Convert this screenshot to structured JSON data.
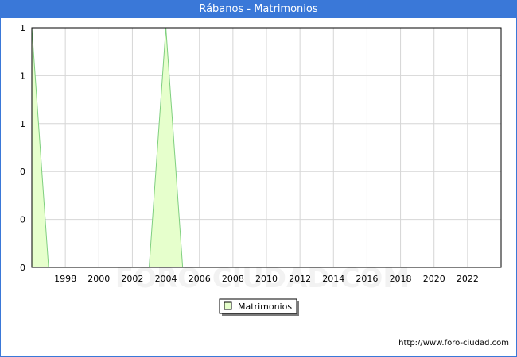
{
  "window": {
    "title": "Rábanos - Matrimonios"
  },
  "watermark": "FORO-CIUDAD.COM",
  "footer": {
    "url": "http://www.foro-ciudad.com"
  },
  "colors": {
    "title_bar": "#3a78d8",
    "area_fill": "#e6ffcc",
    "area_line": "#7fcf7f",
    "grid": "#d6d6d6"
  },
  "chart_data": {
    "type": "area",
    "title": "Rábanos - Matrimonios",
    "xlabel": "",
    "ylabel": "",
    "x_ticks": [
      "1998",
      "2000",
      "2002",
      "2004",
      "2006",
      "2008",
      "2010",
      "2012",
      "2014",
      "2016",
      "2018",
      "2020",
      "2022"
    ],
    "y_ticks": [
      "0",
      "0",
      "0",
      "1",
      "1",
      "1"
    ],
    "xlim": [
      1996,
      2024
    ],
    "ylim": [
      0,
      1
    ],
    "grid": true,
    "legend_position": "bottom-center",
    "series": [
      {
        "name": "Matrimonios",
        "x": [
          1996,
          1997,
          1998,
          1999,
          2000,
          2001,
          2002,
          2003,
          2004,
          2005,
          2006,
          2007,
          2008,
          2009,
          2010,
          2011,
          2012,
          2013,
          2014,
          2015,
          2016,
          2017,
          2018,
          2019,
          2020,
          2021,
          2022,
          2023
        ],
        "values": [
          1,
          0,
          0,
          0,
          0,
          0,
          0,
          0,
          1,
          0,
          0,
          0,
          0,
          0,
          0,
          0,
          0,
          0,
          0,
          0,
          0,
          0,
          0,
          0,
          0,
          0,
          0,
          0
        ]
      }
    ]
  }
}
